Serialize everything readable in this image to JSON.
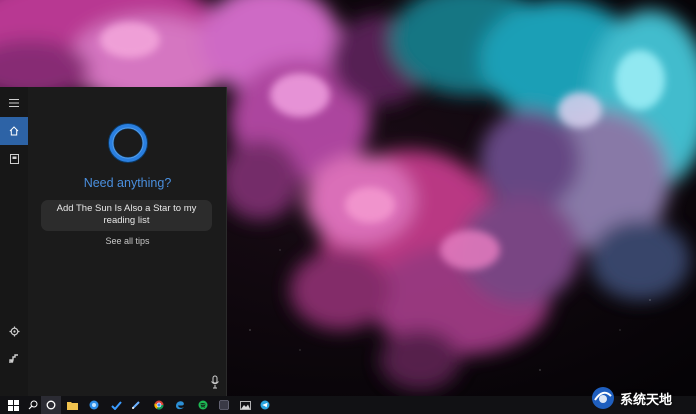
{
  "cortana": {
    "heading": "Need anything?",
    "tip_text": "Add The Sun Is Also a Star to my reading list",
    "see_all_tips": "See all tips",
    "accent_color": "#4a8fde"
  },
  "rail": {
    "items": [
      {
        "icon": "hamburger-menu-icon"
      },
      {
        "icon": "home-icon",
        "selected": true
      },
      {
        "icon": "notebook-icon"
      },
      {
        "icon": "settings-gear-icon"
      },
      {
        "icon": "feedback-icon"
      }
    ]
  },
  "taskbar": {
    "items": [
      {
        "icon": "windows-start-icon"
      },
      {
        "icon": "search-icon"
      },
      {
        "icon": "cortana-circle-icon"
      },
      {
        "icon": "task-view-icon"
      },
      {
        "icon": "file-explorer-icon"
      },
      {
        "icon": "app-icon-blue"
      },
      {
        "icon": "todo-check-icon"
      },
      {
        "icon": "edit-pen-icon"
      },
      {
        "icon": "chrome-icon"
      },
      {
        "icon": "edge-icon"
      },
      {
        "icon": "spotify-icon"
      },
      {
        "icon": "app-icon-dark"
      },
      {
        "icon": "photos-icon"
      },
      {
        "icon": "telegram-icon"
      }
    ]
  },
  "watermark": {
    "text": "系统天地",
    "icon": "system-logo-icon"
  }
}
